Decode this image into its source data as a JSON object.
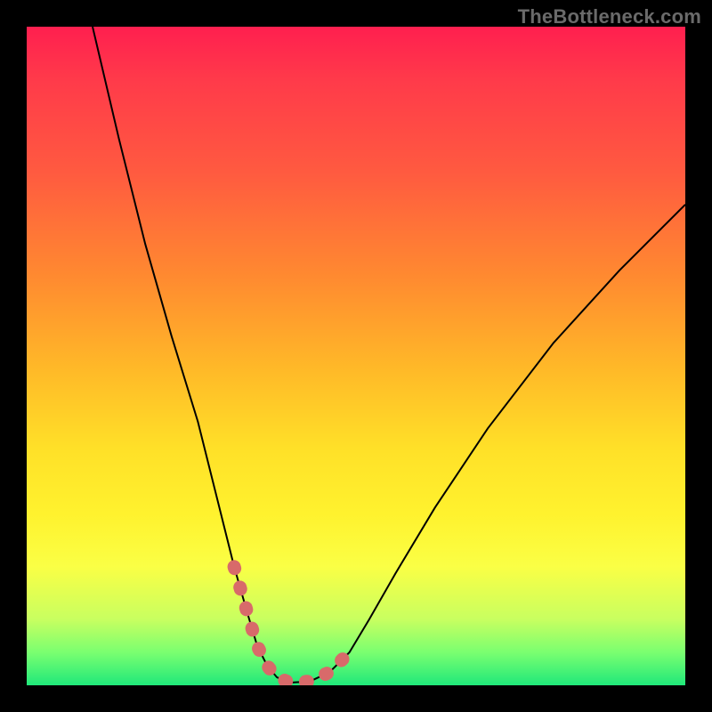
{
  "watermark": "TheBottleneck.com",
  "chart_data": {
    "type": "line",
    "title": "",
    "xlabel": "",
    "ylabel": "",
    "xlim": [
      0,
      100
    ],
    "ylim": [
      0,
      100
    ],
    "grid": false,
    "legend": false,
    "series": [
      {
        "name": "curve",
        "stroke": "#000000",
        "x": [
          10,
          14,
          18,
          22,
          26,
          29,
          31.5,
          33.5,
          35,
          36.5,
          38,
          40,
          43,
          46,
          49,
          52,
          56,
          62,
          70,
          80,
          90,
          100
        ],
        "y": [
          100,
          83,
          67,
          53,
          40,
          28,
          18,
          11,
          6,
          3,
          1.2,
          0.4,
          0.6,
          2,
          5,
          10,
          17,
          27,
          39,
          52,
          63,
          73
        ]
      },
      {
        "name": "trough-highlight",
        "stroke": "#d86a6a",
        "x": [
          31.5,
          33.5,
          35,
          36.5,
          38,
          40,
          43,
          46,
          49
        ],
        "y": [
          18,
          11,
          6,
          3,
          1.2,
          0.4,
          0.6,
          2,
          5
        ]
      }
    ]
  },
  "colors": {
    "background": "#000000",
    "watermark": "#6a6a6a",
    "curve": "#000000",
    "highlight": "#d86a6a"
  }
}
